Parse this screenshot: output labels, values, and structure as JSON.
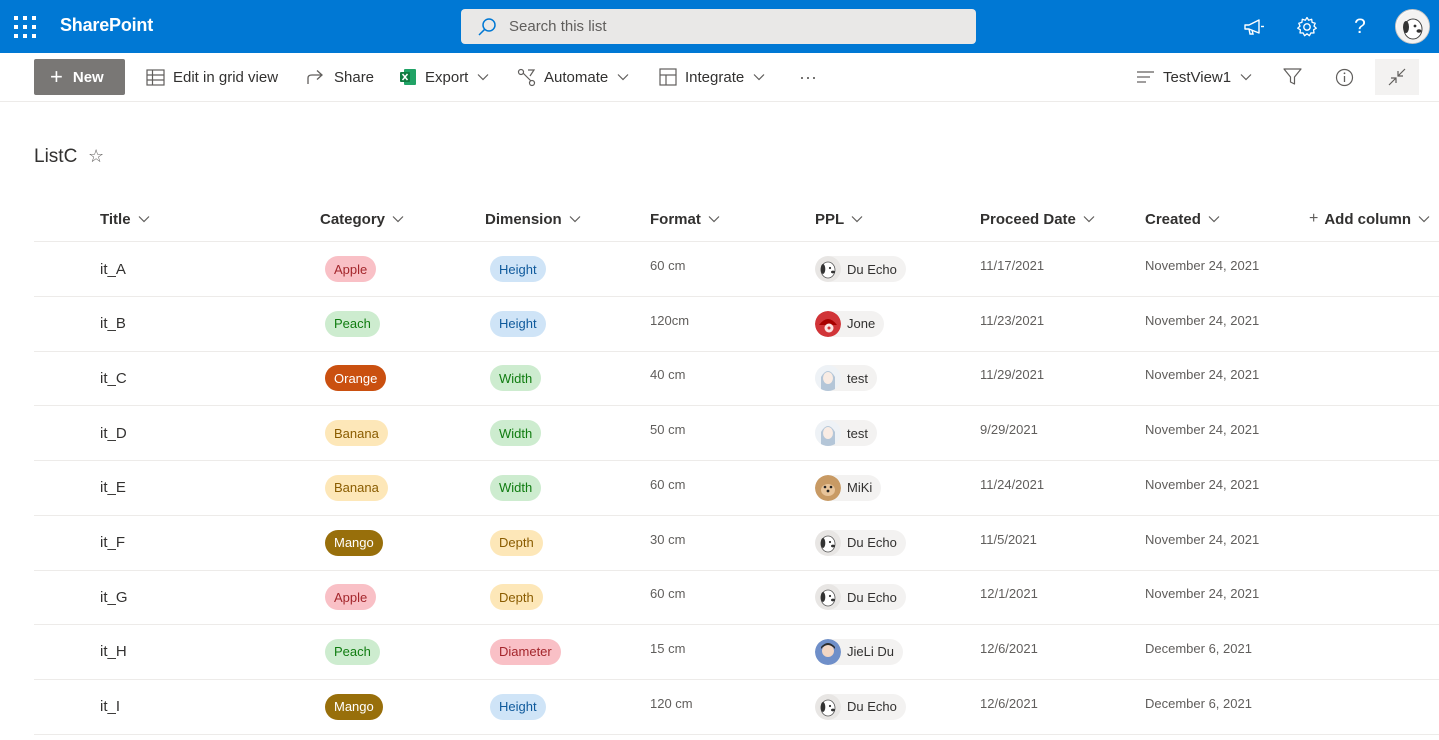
{
  "suite": {
    "app_name": "SharePoint",
    "search_placeholder": "Search this list",
    "bg_color": "#0078d4"
  },
  "commands": {
    "new": "New",
    "edit_grid": "Edit in grid view",
    "share": "Share",
    "export": "Export",
    "automate": "Automate",
    "integrate": "Integrate",
    "more": "···",
    "view_name": "TestView1"
  },
  "list": {
    "title": "ListC",
    "star": "☆"
  },
  "columns": {
    "title": "Title",
    "category": "Category",
    "dimension": "Dimension",
    "format": "Format",
    "ppl": "PPL",
    "proceed_date": "Proceed Date",
    "created": "Created",
    "add_column": "Add column"
  },
  "rows": [
    {
      "title": "it_A",
      "category": "Apple",
      "dimension": "Height",
      "format": "60 cm",
      "ppl": "Du Echo",
      "proceed_date": "11/17/2021",
      "created": "November 24, 2021"
    },
    {
      "title": "it_B",
      "category": "Peach",
      "dimension": "Height",
      "format": "120cm",
      "ppl": "Jone",
      "proceed_date": "11/23/2021",
      "created": "November 24, 2021"
    },
    {
      "title": "it_C",
      "category": "Orange",
      "dimension": "Width",
      "format": "40 cm",
      "ppl": "test",
      "proceed_date": "11/29/2021",
      "created": "November 24, 2021"
    },
    {
      "title": "it_D",
      "category": "Banana",
      "dimension": "Width",
      "format": "50 cm",
      "ppl": "test",
      "proceed_date": "9/29/2021",
      "created": "November 24, 2021"
    },
    {
      "title": "it_E",
      "category": "Banana",
      "dimension": "Width",
      "format": "60 cm",
      "ppl": "MiKi",
      "proceed_date": "11/24/2021",
      "created": "November 24, 2021"
    },
    {
      "title": "it_F",
      "category": "Mango",
      "dimension": "Depth",
      "format": "30 cm",
      "ppl": "Du Echo",
      "proceed_date": "11/5/2021",
      "created": "November 24, 2021"
    },
    {
      "title": "it_G",
      "category": "Apple",
      "dimension": "Depth",
      "format": "60 cm",
      "ppl": "Du Echo",
      "proceed_date": "12/1/2021",
      "created": "November 24, 2021"
    },
    {
      "title": "it_H",
      "category": "Peach",
      "dimension": "Diameter",
      "format": "15 cm",
      "ppl": "JieLi Du",
      "proceed_date": "12/6/2021",
      "created": "December 6, 2021"
    },
    {
      "title": "it_I",
      "category": "Mango",
      "dimension": "Height",
      "format": "120 cm",
      "ppl": "Du Echo",
      "proceed_date": "12/6/2021",
      "created": "December 6, 2021"
    }
  ],
  "pill_colors": {
    "Apple": {
      "bg": "#f9c0c6",
      "fg": "#a4262c"
    },
    "Peach": {
      "bg": "#cdeccf",
      "fg": "#107c10"
    },
    "Orange": {
      "bg": "#ca5010",
      "fg": "#ffffff"
    },
    "Banana": {
      "bg": "#fde7b8",
      "fg": "#8a5c00"
    },
    "Mango": {
      "bg": "#986f0b",
      "fg": "#ffffff"
    },
    "Height": {
      "bg": "#cfe4f7",
      "fg": "#0f5a9c"
    },
    "Width": {
      "bg": "#cdeccf",
      "fg": "#107c10"
    },
    "Depth": {
      "bg": "#fde7b8",
      "fg": "#8a5c00"
    },
    "Diameter": {
      "bg": "#f9c0c6",
      "fg": "#a4262c"
    }
  },
  "avatar_colors": {
    "Du Echo": "#e8e6e4",
    "Jone": "#d13438",
    "test": "#b4c6d8",
    "MiKi": "#c89a64",
    "JieLi Du": "#6f8fc9"
  }
}
